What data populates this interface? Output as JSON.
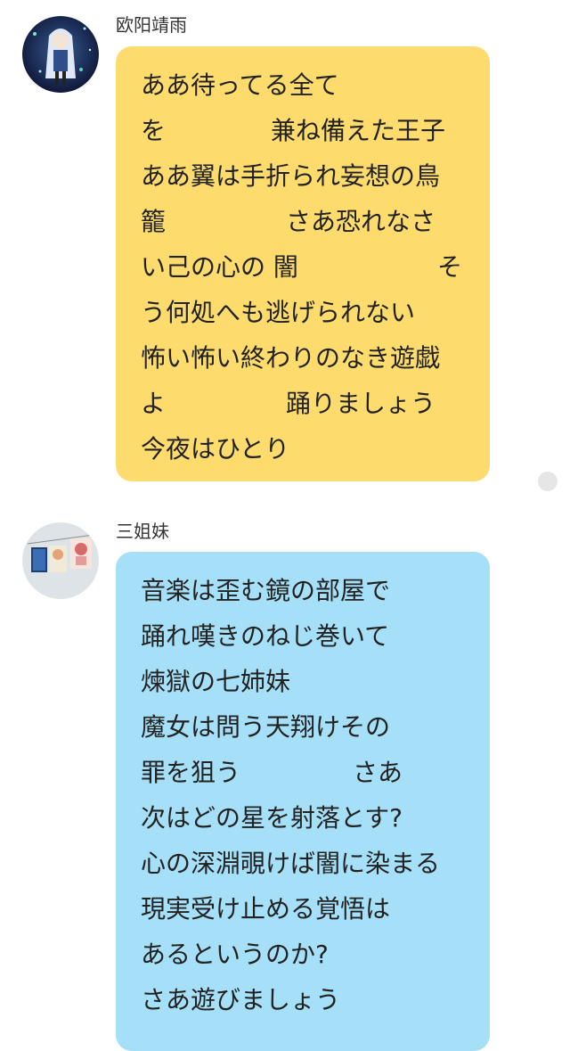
{
  "messages": [
    {
      "sender": "欧阳靖雨",
      "bubble_color": "#FDDB6D",
      "lines": [
        [
          "ああ待ってる全て",
          ""
        ],
        [
          "を",
          "兼ね備えた王子"
        ],
        [
          "ああ翼は手折られ妄想の鳥",
          ""
        ],
        [
          "籠",
          "さあ恐れなさ"
        ],
        [
          "い己の心の 闇",
          "そ"
        ],
        [
          "う何処へも逃げられない",
          ""
        ],
        [
          "怖い怖い終わりのなき遊戯",
          ""
        ],
        [
          "よ",
          "踊りましょう"
        ],
        [
          "今夜はひとり",
          ""
        ]
      ]
    },
    {
      "sender": "三姐妹",
      "bubble_color": "#A6E0F8",
      "lines": [
        [
          "音楽は歪む鏡の部屋で",
          ""
        ],
        [
          "踊れ嘆きのねじ巻いて",
          ""
        ],
        [
          "煉獄の七姉妹",
          ""
        ],
        [
          "魔女は問う天翔けその",
          ""
        ],
        [
          "罪を狙う",
          "さあ"
        ],
        [
          "次はどの星を射落とす?",
          ""
        ],
        [
          "心の深淵覗けば闇に染まる",
          ""
        ],
        [
          "現実受け止める覚悟は",
          ""
        ],
        [
          "あるというのか?",
          ""
        ],
        [
          "さあ遊びましょう",
          ""
        ]
      ]
    }
  ]
}
